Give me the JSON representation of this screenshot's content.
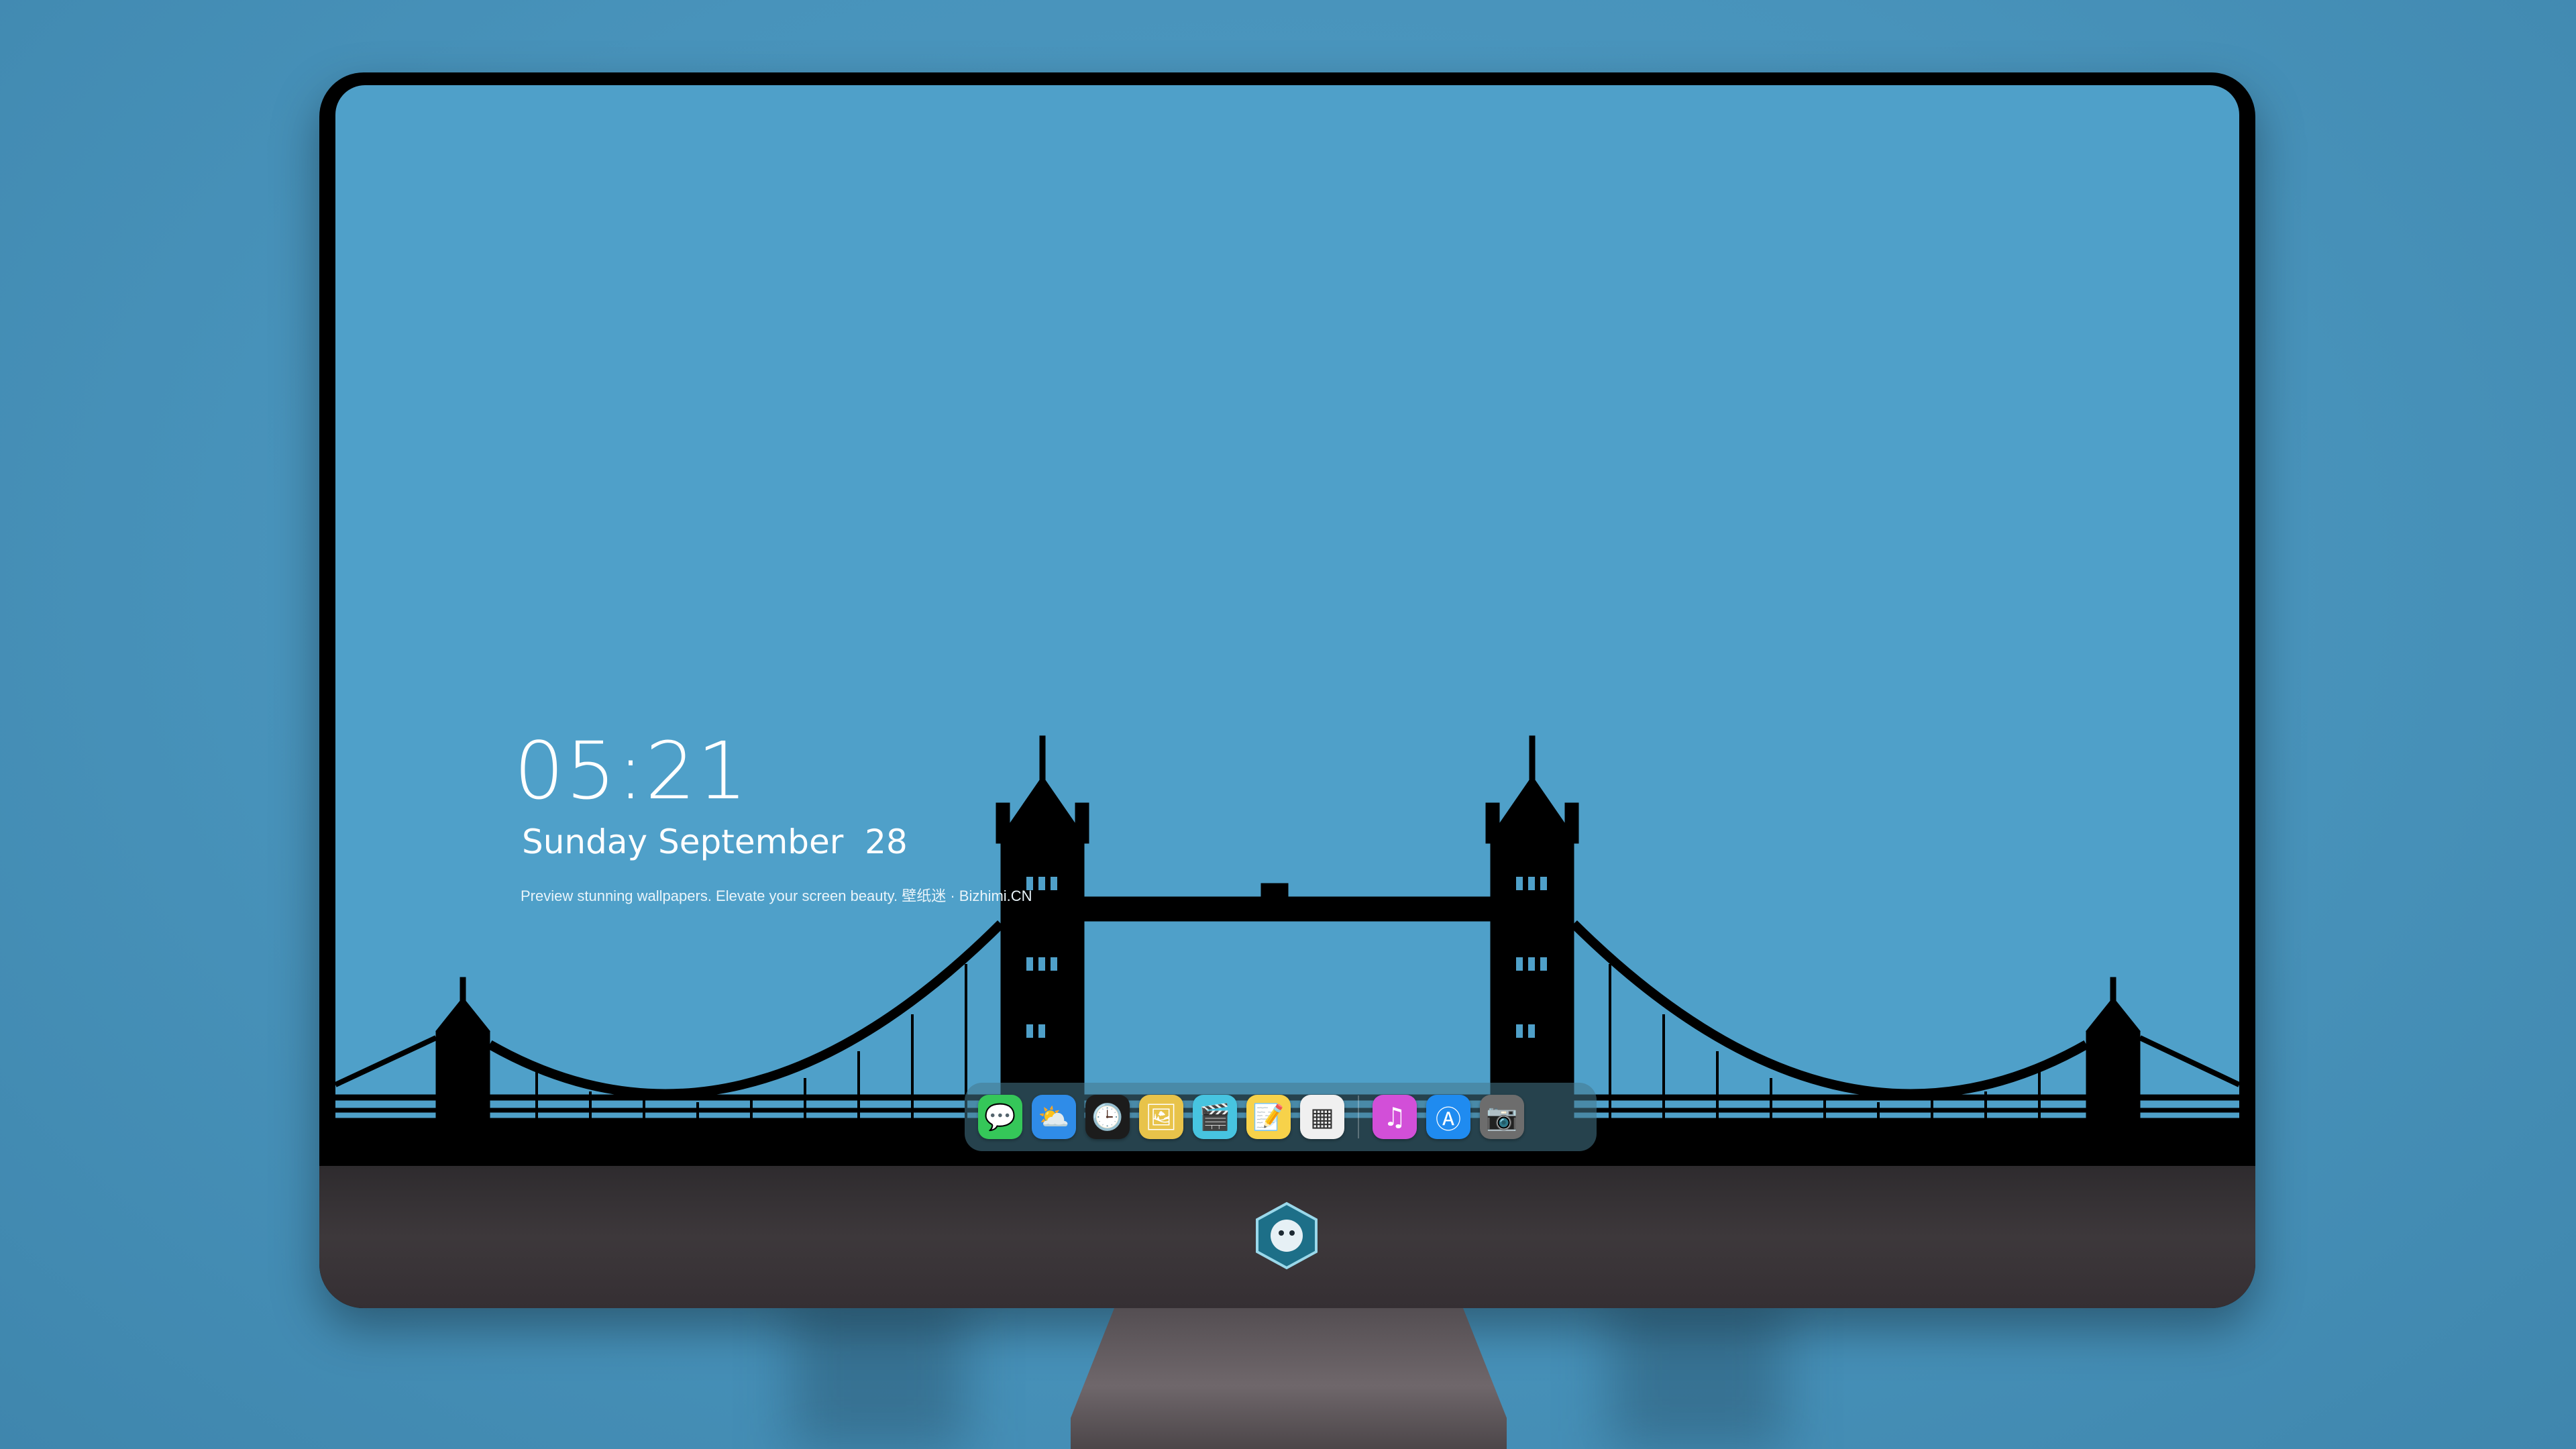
{
  "lockscreen": {
    "time": "05:21",
    "date": "Sunday September  28",
    "tagline": "Preview stunning wallpapers. Elevate your screen beauty. 壁纸迷 · Bizhimi.CN"
  },
  "dock": {
    "apps": [
      {
        "name": "Messages",
        "icon": "messages-icon",
        "color": "#35c759"
      },
      {
        "name": "Weather",
        "icon": "weather-icon",
        "color": "#2f8ce8"
      },
      {
        "name": "Clock",
        "icon": "clock-icon",
        "color": "#1c1c1c"
      },
      {
        "name": "Preview",
        "icon": "preview-icon",
        "color": "#e8c34a"
      },
      {
        "name": "Clips",
        "icon": "clips-icon",
        "color": "#47c4e0"
      },
      {
        "name": "Notes",
        "icon": "notes-icon",
        "color": "#f7d24a"
      },
      {
        "name": "Photos",
        "icon": "photos-icon",
        "color": "#f0f0f0"
      },
      {
        "name": "iTunes",
        "icon": "music-icon",
        "color": "#d24fd8"
      },
      {
        "name": "App Store",
        "icon": "app-store-icon",
        "color": "#1f8bf0"
      },
      {
        "name": "Camera",
        "icon": "camera-icon",
        "color": "#6d6d6d"
      }
    ]
  },
  "colors": {
    "wallpaper": "#4fa0c9",
    "silhouette": "#000000",
    "bezel": "#000000",
    "chin": "#3a3538"
  }
}
